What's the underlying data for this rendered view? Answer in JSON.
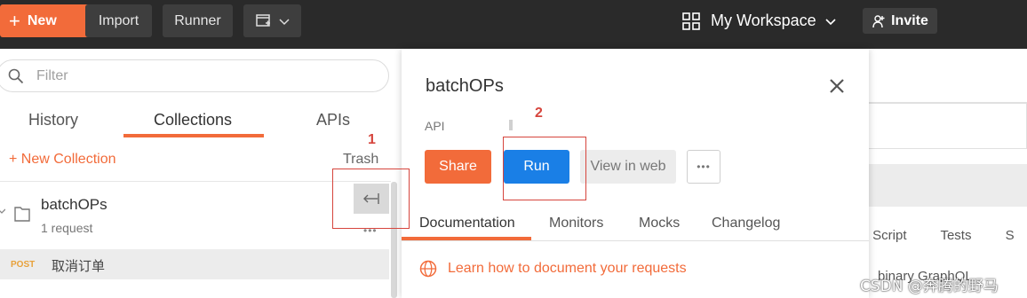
{
  "topbar": {
    "new_label": "New",
    "import_label": "Import",
    "runner_label": "Runner",
    "workspace_label": "My Workspace",
    "invite_label": "Invite"
  },
  "sidebar": {
    "filter_placeholder": "Filter",
    "tabs": [
      {
        "label": "History",
        "active": false
      },
      {
        "label": "Collections",
        "active": true
      },
      {
        "label": "APIs",
        "active": false
      }
    ],
    "new_collection_label": "+ New Collection",
    "trash_label": "Trash",
    "collections": [
      {
        "name": "batchOPs",
        "count": "1 request",
        "requests": [
          {
            "method": "POST",
            "name": "取消订单"
          }
        ]
      }
    ]
  },
  "annotations": [
    {
      "number": "1"
    },
    {
      "number": "2"
    }
  ],
  "panel": {
    "title": "batchOPs",
    "api_label": "API",
    "share_label": "Share",
    "run_label": "Run",
    "view_web_label": "View in web",
    "tabs": [
      {
        "label": "Documentation",
        "active": true
      },
      {
        "label": "Monitors",
        "active": false
      },
      {
        "label": "Mocks",
        "active": false
      },
      {
        "label": "Changelog",
        "active": false
      }
    ],
    "learn_link": "Learn how to document your requests"
  },
  "background": {
    "tabs": [
      "est Script",
      "Tests",
      "S"
    ],
    "bottom_text": "binary   GraphQL"
  },
  "watermark": "CSDN @奔腾的野马",
  "colors": {
    "accent": "#f26b3a",
    "run_blue": "#1a7fe6",
    "annotation_red": "#d6453d",
    "topbar": "#2a2a2a"
  }
}
